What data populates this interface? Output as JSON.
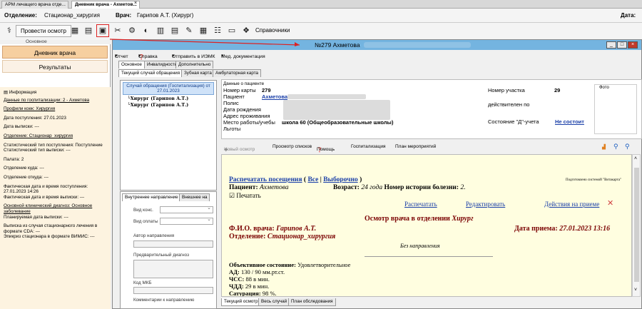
{
  "tabs": [
    "АРМ лечащего врача отде...",
    "Дневник врача - Ахметов..."
  ],
  "header": {
    "dept_label": "Отделение:",
    "dept_value": "Стационар_хирургия",
    "doctor_label": "Врач:",
    "doctor_value": "Гарипов А.Т. (Хирург)",
    "date_label": "Дата:"
  },
  "toolbar": {
    "conduct_label": "Провести осмотр",
    "refs_label": "Справочники",
    "group_label": "Основное"
  },
  "leftnav": {
    "diary": "Дневник врача",
    "results": "Результаты"
  },
  "info": {
    "heading": "Информация",
    "items": [
      "Данные по госпитализации: 2 - Ахметова",
      "Профили коек: Хирургия",
      "Дата поступления: 27.01.2023",
      "Дата выписки: ---",
      "Отделение: Стационар_хирургия",
      "Статистический тип поступления: Поступление",
      "Статистический тип выписки: ---",
      "Палата: 2",
      "Отделение куда: ---",
      "Отделение откуда: ---",
      "Фактическая дата и время поступления: 27.01.2023 14:26",
      "Фактическая дата и время выписки: ---",
      "Основной клинический диагноз: Основное заболевание",
      "Планируемая дата выписки: ---",
      "Выписка из случая стационарного лечения в формате CDA: ---",
      "Эпикриз стационара в формате ВИМИС: ---"
    ]
  },
  "modal": {
    "title": "№279 Ахметова",
    "menu": [
      "Отчет",
      "Справка",
      "Отправить в ИЭМК",
      "Мед. документация"
    ],
    "tabs1": [
      "Основное",
      "Инвалидность",
      "Дополнительно"
    ],
    "tabs2": [
      "Текущий случай обращения",
      "Зубная карта",
      "Амбулаторная карта"
    ],
    "case_header": "Случай обращения (Госпитализация) от 27.01.2023",
    "case_items": [
      "Хирург (Гарипов А.Т.)",
      "Хирург (Гарипов А.Т.)"
    ],
    "dir_tabs": [
      "Внутреннее направление",
      "Внешнее на"
    ],
    "dir_fields": {
      "vid_kons": "Вид конс.",
      "vid_oplaty": "Вид оплаты",
      "avtor": "Автор направления",
      "diag": "Предварительный диагноз",
      "mkb": "Код МКБ",
      "comment": "Комментарии к направлению"
    }
  },
  "patient": {
    "section": "Данные о пациенте",
    "card_label": "Номер карты",
    "card_value": "279",
    "name_label": "Пациент",
    "name_value": "Ахметова",
    "polis_label": "Полис",
    "dob_label": "Дата рождения",
    "addr_label": "Адрес проживания",
    "work_label": "Место работы/учебы",
    "work_value": "школа 60 (Общеобразовательные школы)",
    "benefits_label": "Льготы",
    "uchastok_label": "Номер участка",
    "uchastok_value": "29",
    "valid_label": "действителен по",
    "d_label": "Состояние \"Д\"-учета",
    "d_value": "Не состоит",
    "photo_label": "Фото"
  },
  "actions": [
    "Новый осмотр",
    "Просмотр списков",
    "Помощь",
    "Госпитализация",
    "План мероприятий"
  ],
  "doc": {
    "print_visits": "Распечатать посещения",
    "all": "Все",
    "selected": "Выборочно",
    "powered": "Подготовлено системой \"Витакарта\"",
    "patient_label": "Пациент:",
    "patient_name": "Ахметова",
    "age_label": "Возраст:",
    "age_value": "24 года",
    "history_label": "Номер истории болезни:",
    "history_value": "2.",
    "print_chk": "Печатать",
    "print": "Распечатать",
    "edit": "Редактировать",
    "actions_on": "Действия на приеме",
    "exam_title": "Осмотр врача в отделении",
    "exam_dept": "Хирург",
    "fio_label": "Ф.И.О. врача:",
    "fio_value": "Гарипов А.Т.",
    "date_label": "Дата приема:",
    "date_value": "27.01.2023 13:16",
    "dept_label": "Отделение:",
    "dept_value": "Стационар_хирургия",
    "no_dir": "Без направления",
    "obj_label": "Объективное состояние:",
    "obj_value": "Удовлетворительное",
    "ad": "АД:",
    "ad_v": "130 / 90 мм.рт.ст.",
    "chss": "ЧСС:",
    "chss_v": "88 в мин.",
    "chdd": "ЧДД:",
    "chdd_v": "29 в мин.",
    "sat": "Сатурация:",
    "sat_v": "98 %."
  },
  "bottom_tabs": [
    "Текущий осмотр",
    "Весь случай",
    "План обследования"
  ]
}
